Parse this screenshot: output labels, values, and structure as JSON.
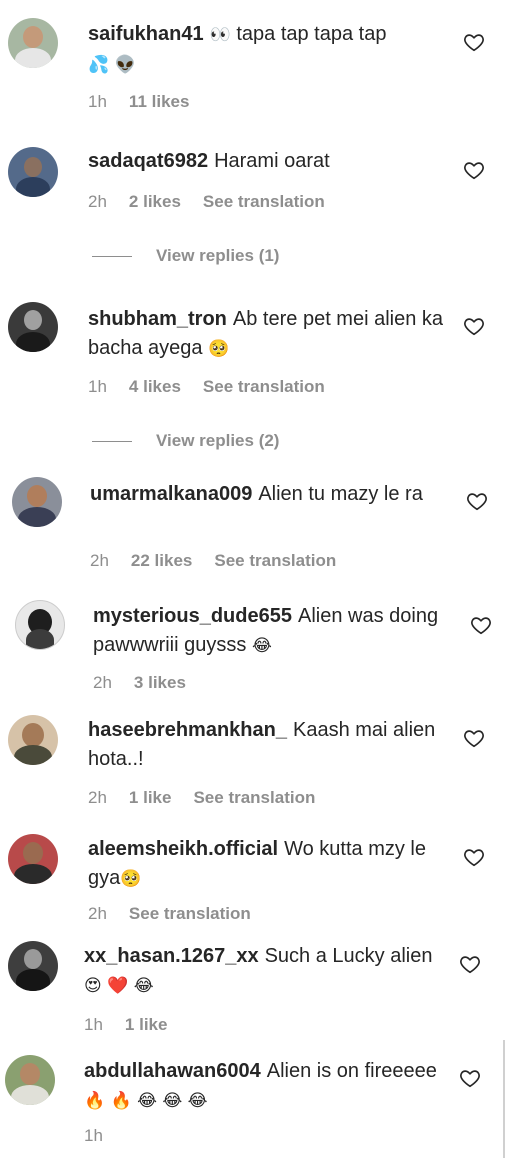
{
  "comments": [
    {
      "username": "saifukhan41",
      "text_before": "",
      "emoji": "👀",
      "text": "tapa tap tapa tap",
      "text_emoji": "💦 👽",
      "time": "1h",
      "likes": "11 likes",
      "translation": ""
    },
    {
      "username": "sadaqat6982",
      "text": "Harami oarat",
      "time": "2h",
      "likes": "2 likes",
      "translation": "See translation",
      "replies": "View replies (1)"
    },
    {
      "username": "shubham_tron",
      "text": "Ab tere pet mei alien ka bacha ayega",
      "text_emoji": "🥺",
      "time": "1h",
      "likes": "4 likes",
      "translation": "See translation",
      "replies": "View replies (2)"
    },
    {
      "username": "umarmalkana009",
      "text": "Alien tu mazy le ra",
      "time": "2h",
      "likes": "22 likes",
      "translation": "See translation"
    },
    {
      "username": "mysterious_dude655",
      "text": "Alien was doing pawwwriii guysss",
      "text_emoji": "😂",
      "time": "2h",
      "likes": "3 likes"
    },
    {
      "username": "haseebrehmankhan_",
      "text": "Kaash mai alien hota..!",
      "time": "2h",
      "likes": "1 like",
      "translation": "See translation"
    },
    {
      "username": "aleemsheikh.official",
      "text": "Wo kutta mzy le gya",
      "text_emoji": "🥺",
      "time": "2h",
      "translation": "See translation"
    },
    {
      "username": "xx_hasan.1267_xx",
      "text": "Such a Lucky alien",
      "text_emoji": "😍 ❤️ 😂",
      "time": "1h",
      "likes": "1 like"
    },
    {
      "username": "abdullahawan6004",
      "text": "Alien is on fireeeee",
      "text_emoji": "🔥 🔥 😂 😂 😂",
      "time": "1h"
    }
  ],
  "icons": {
    "like": "heart-outline-icon"
  },
  "colors": {
    "text": "#262626",
    "muted": "#8e8e8e",
    "background": "#ffffff"
  }
}
